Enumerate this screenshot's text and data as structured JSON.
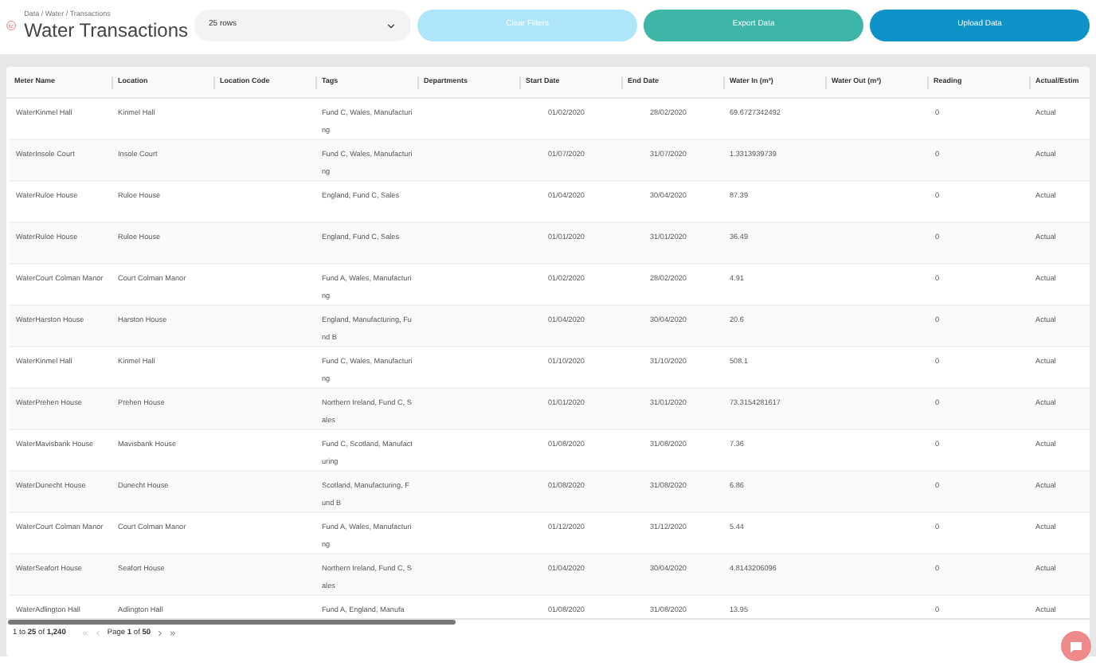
{
  "breadcrumb": "Data / Water / Transactions",
  "title": "Water Transactions",
  "rows_select": {
    "value": "25 rows"
  },
  "buttons": [
    {
      "label": "Clear Filters",
      "kind": "clear",
      "disabled": true
    },
    {
      "label": "Export Data",
      "kind": "export",
      "disabled": false
    },
    {
      "label": "Upload Data",
      "kind": "upload",
      "disabled": false
    }
  ],
  "table": {
    "columns": [
      "Meter Name",
      "Location",
      "Location Code",
      "Tags",
      "Departments",
      "Start Date",
      "End Date",
      "Water In (m³)",
      "Water Out (m³)",
      "Reading",
      "Actual/Estim"
    ],
    "rows": [
      {
        "meter_name": "WaterKinmel Hall",
        "location": "Kinmel Hall",
        "tags": "Fund C, Wales, Manufacturing",
        "start_date": "01/02/2020",
        "end_date": "28/02/2020",
        "water_in": "69.6727342492",
        "reading": "0",
        "actual": "Actual"
      },
      {
        "meter_name": "WaterInsole Court",
        "location": "Insole Court",
        "tags": "Fund C, Wales, Manufacturing",
        "start_date": "01/07/2020",
        "end_date": "31/07/2020",
        "water_in": "1.3313939739",
        "reading": "0",
        "actual": "Actual"
      },
      {
        "meter_name": "WaterRuloe House",
        "location": "Ruloe House",
        "tags": "England, Fund C, Sales",
        "start_date": "01/04/2020",
        "end_date": "30/04/2020",
        "water_in": "87.39",
        "reading": "0",
        "actual": "Actual"
      },
      {
        "meter_name": "WaterRuloe House",
        "location": "Ruloe House",
        "tags": "England, Fund C, Sales",
        "start_date": "01/01/2020",
        "end_date": "31/01/2020",
        "water_in": "36.49",
        "reading": "0",
        "actual": "Actual"
      },
      {
        "meter_name": "WaterCourt Colman Manor",
        "location": "Court Colman Manor",
        "tags": "Fund A, Wales, Manufacturing",
        "start_date": "01/02/2020",
        "end_date": "28/02/2020",
        "water_in": "4.91",
        "reading": "0",
        "actual": "Actual"
      },
      {
        "meter_name": "WaterHarston House",
        "location": "Harston House",
        "tags": "England, Manufacturing, Fund B",
        "start_date": "01/04/2020",
        "end_date": "30/04/2020",
        "water_in": "20.6",
        "reading": "0",
        "actual": "Actual"
      },
      {
        "meter_name": "WaterKinmel Hall",
        "location": "Kinmel Hall",
        "tags": "Fund C, Wales, Manufacturing",
        "start_date": "01/10/2020",
        "end_date": "31/10/2020",
        "water_in": "508.1",
        "reading": "0",
        "actual": "Actual"
      },
      {
        "meter_name": "WaterPrehen House",
        "location": "Prehen House",
        "tags": "Northern Ireland, Fund C, Sales",
        "start_date": "01/01/2020",
        "end_date": "31/01/2020",
        "water_in": "73.3154281617",
        "reading": "0",
        "actual": "Actual"
      },
      {
        "meter_name": "WaterMavisbank House",
        "location": "Mavisbank House",
        "tags": "Fund C, Scotland, Manufacturing",
        "start_date": "01/08/2020",
        "end_date": "31/08/2020",
        "water_in": "7.36",
        "reading": "0",
        "actual": "Actual"
      },
      {
        "meter_name": "WaterDunecht House",
        "location": "Dunecht House",
        "tags": "Scotland, Manufacturing, Fund B",
        "start_date": "01/08/2020",
        "end_date": "31/08/2020",
        "water_in": "6.86",
        "reading": "0",
        "actual": "Actual"
      },
      {
        "meter_name": "WaterCourt Colman Manor",
        "location": "Court Colman Manor",
        "tags": "Fund A, Wales, Manufacturing",
        "start_date": "01/12/2020",
        "end_date": "31/12/2020",
        "water_in": "5.44",
        "reading": "0",
        "actual": "Actual"
      },
      {
        "meter_name": "WaterSeafort House",
        "location": "Seafort House",
        "tags": "Northern Ireland, Fund C, Sales",
        "start_date": "01/04/2020",
        "end_date": "30/04/2020",
        "water_in": "4.8143206096",
        "reading": "0",
        "actual": "Actual"
      },
      {
        "meter_name": "WaterAdlington Hall",
        "location": "Adlington Hall",
        "tags": "Fund A, England, Manufa",
        "start_date": "01/08/2020",
        "end_date": "31/08/2020",
        "water_in": "13.95",
        "reading": "0",
        "actual": "Actual"
      }
    ]
  },
  "footer": {
    "summary": "1 to **25** of **1,240**",
    "page": "Page **1** of **50**"
  }
}
